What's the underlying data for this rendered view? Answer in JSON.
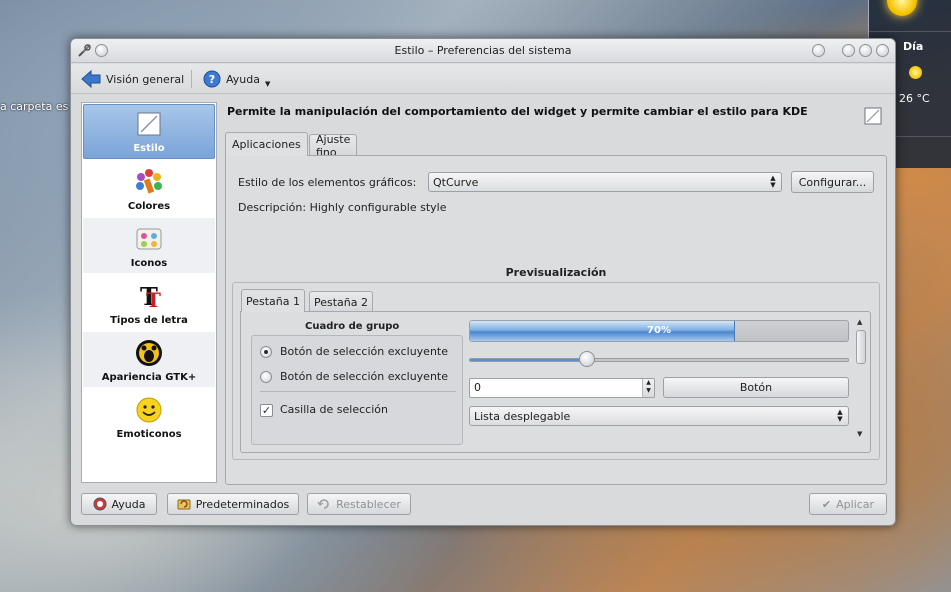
{
  "desktop": {
    "folder_text": "a carpeta es",
    "weather": {
      "day_label": "Día",
      "temperature": "26 °C"
    }
  },
  "window": {
    "title": "Estilo – Preferencias del sistema"
  },
  "toolbar": {
    "overview_label": "Visión general",
    "help_label": "Ayuda"
  },
  "sidebar": {
    "items": [
      {
        "label": "Estilo",
        "icon": "style-icon",
        "selected": true
      },
      {
        "label": "Colores",
        "icon": "colors-icon"
      },
      {
        "label": "Iconos",
        "icon": "icons-icon"
      },
      {
        "label": "Tipos de letra",
        "icon": "fonts-icon"
      },
      {
        "label": "Apariencia GTK+",
        "icon": "gtk-icon"
      },
      {
        "label": "Emoticonos",
        "icon": "emoticons-icon"
      }
    ]
  },
  "main": {
    "heading": "Permite la manipulación del comportamiento del widget y permite cambiar el estilo para KDE",
    "tabs": [
      {
        "label": "Aplicaciones",
        "active": true
      },
      {
        "label": "Ajuste fino"
      }
    ],
    "widget_style_label": "Estilo de los elementos gráficos:",
    "widget_style_value": "QtCurve",
    "configure_button": "Configurar...",
    "description": "Descripción: Highly configurable style",
    "preview_title": "Previsualización",
    "preview": {
      "tabs": [
        {
          "label": "Pestaña 1",
          "active": true
        },
        {
          "label": "Pestaña 2"
        }
      ],
      "group_title": "Cuadro de grupo",
      "radio_1": "Botón de selección excluyente",
      "radio_2": "Botón de selección excluyente",
      "checkbox": "Casilla de selección",
      "progress_text": "70%",
      "progress_value": 0.7,
      "slider_value": 0.31,
      "spin_value": "0",
      "button": "Botón",
      "dropdown": "Lista desplegable"
    }
  },
  "footer": {
    "help_button": "Ayuda",
    "defaults_button": "Predeterminados",
    "reset_button": "Restablecer",
    "apply_button": "Aplicar"
  },
  "colors": {
    "selection": "#7aa4d8",
    "progress": "#4a86cf",
    "window_bg": "#d9dadc"
  }
}
